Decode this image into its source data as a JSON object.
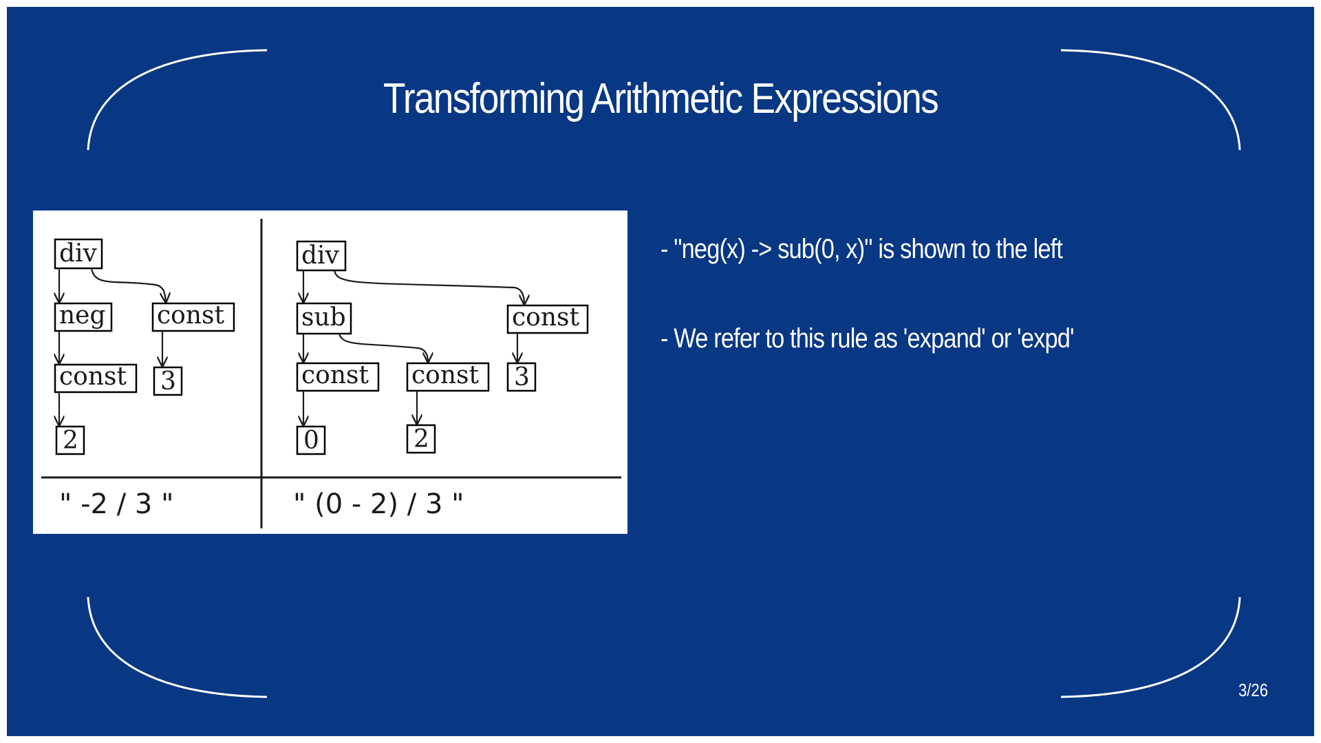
{
  "slide": {
    "title": "Transforming Arithmetic Expressions",
    "bullets": [
      "- \"neg(x) -> sub(0, x)\" is shown to the left",
      "- We refer to this rule as 'expand' or 'expd'"
    ],
    "page_number": "3/26"
  },
  "figure": {
    "left_tree": {
      "root": "div",
      "neg": "neg",
      "const_a": "const",
      "const_b": "const",
      "leaf_a": "2",
      "leaf_b": "3",
      "expression": "\" -2 / 3 \""
    },
    "right_tree": {
      "root": "div",
      "sub": "sub",
      "const_a": "const",
      "const_b": "const",
      "const_c": "const",
      "leaf_a": "0",
      "leaf_b": "2",
      "leaf_c": "3",
      "expression": "\" (0 - 2) / 3 \""
    }
  },
  "colors": {
    "background": "#083784",
    "text": "#ffffff"
  }
}
